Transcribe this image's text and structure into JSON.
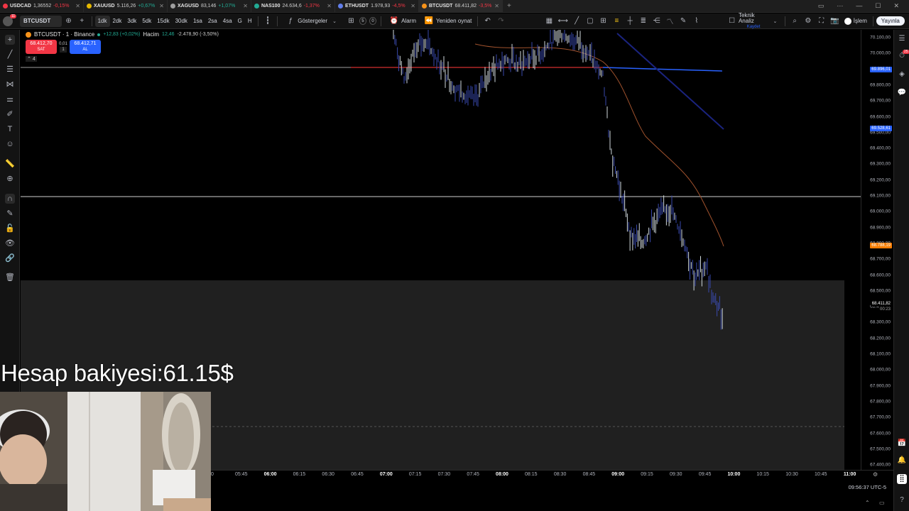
{
  "tabs": [
    {
      "symbol": "USDCAD",
      "price": "1,36552",
      "change": "-0,15%",
      "color": "#f23645",
      "up": false
    },
    {
      "symbol": "XAUUSD",
      "price": "5.116,26",
      "change": "+0,67%",
      "color": "#e6b800",
      "up": true
    },
    {
      "symbol": "XAGUSD",
      "price": "83,146",
      "change": "+1,07%",
      "color": "#9e9e9e",
      "up": true
    },
    {
      "symbol": "NAS100",
      "price": "24.634,6",
      "change": "-1,37%",
      "color": "#22ab94",
      "up": false
    },
    {
      "symbol": "ETHUSDT",
      "price": "1.978,93",
      "change": "-4,5%",
      "color": "#627eea",
      "up": false
    },
    {
      "symbol": "BTCUSDT",
      "price": "68.411,82",
      "change": "-3,5%",
      "color": "#f7931a",
      "up": false
    }
  ],
  "tab_add": "+",
  "toolbar": {
    "notification_count": "11",
    "symbol": "BTCUSDT",
    "intervals": [
      "1dk",
      "2dk",
      "3dk",
      "5dk",
      "15dk",
      "30dk",
      "1sa",
      "2sa",
      "4sa",
      "G",
      "H"
    ],
    "active_interval": "1dk",
    "indicators_label": "Göstergeler",
    "badge1": "5",
    "badge2": "0",
    "alarm_label": "Alarm",
    "replay_label": "Yeniden oynat",
    "ta_label": "Teknik Analiz",
    "ta_sub": "Kaydet",
    "trade_label": "İşlem",
    "publish_label": "Yayınla"
  },
  "legend": {
    "title": "BTCUSDT · 1 · Binance",
    "change": "+12,83 (+0,02%)",
    "volume_label": "Hacim",
    "volume_value": "12,46",
    "volume_change": "-2.478,90 (-3,50%)",
    "sell_price": "68.412,70",
    "sell_label": "SAT",
    "spread_top": "0,01",
    "spread_bottom": "1",
    "buy_price": "68.412,71",
    "buy_label": "AL",
    "collapse": "4"
  },
  "price_axis": {
    "ticks": [
      "70.100,00",
      "70.000,00",
      "69.900,00",
      "69.800,00",
      "69.700,00",
      "69.600,00",
      "69.500,00",
      "69.400,00",
      "69.300,00",
      "69.200,00",
      "69.100,00",
      "69.000,00",
      "68.900,00",
      "68.800,00",
      "68.700,00",
      "68.600,00",
      "68.500,00",
      "68.400,00",
      "68.300,00",
      "68.200,00",
      "68.100,00",
      "68.000,00",
      "67.900,00",
      "67.800,00",
      "67.700,00",
      "67.600,00",
      "67.500,00",
      "67.400,00"
    ],
    "label_blue_line": "69.896,01",
    "label_blue_line2": "69.528,61",
    "label_orange": "68.788,19",
    "label_current": "68.411,82",
    "label_countdown": "00:23",
    "blue_color": "#2962ff",
    "orange_color": "#f57c00"
  },
  "time_axis": {
    "ticks": [
      "0",
      "05:45",
      "06:00",
      "06:15",
      "06:30",
      "06:45",
      "07:00",
      "07:15",
      "07:30",
      "07:45",
      "08:00",
      "08:15",
      "08:30",
      "08:45",
      "09:00",
      "09:15",
      "09:30",
      "09:45",
      "10:00",
      "10:15",
      "10:30",
      "10:45",
      "11:00"
    ],
    "bold": [
      "06:00",
      "07:00",
      "08:00",
      "09:00",
      "10:00",
      "11:00"
    ]
  },
  "clock": "09:56:37 UTC-5",
  "overlay": {
    "balance": "Hesap bakiyesi:61.15$"
  },
  "right_notification": "25"
}
